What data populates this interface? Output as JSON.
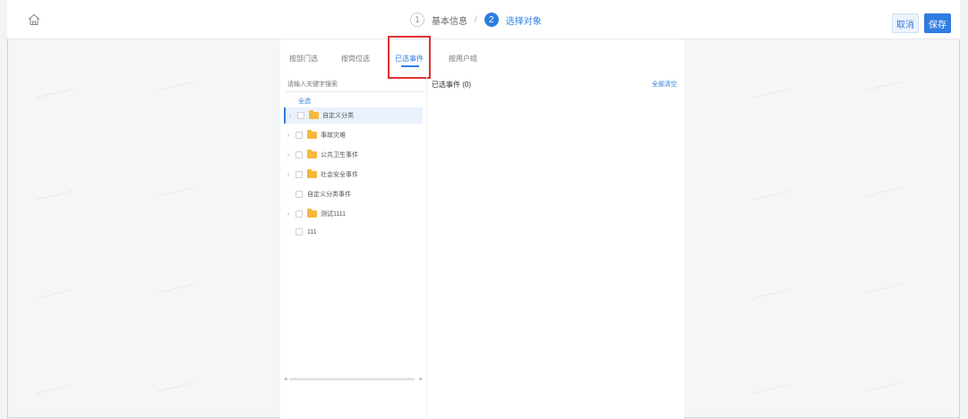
{
  "header": {
    "steps": [
      {
        "num": "1",
        "label": "基本信息"
      },
      {
        "num": "2",
        "label": "选择对象"
      }
    ],
    "cancel_label": "取消",
    "save_label": "保存"
  },
  "tabs": [
    {
      "label": "按部门选"
    },
    {
      "label": "按岗位选"
    },
    {
      "label": "已选事件"
    },
    {
      "label": "按用户组"
    }
  ],
  "left_panel": {
    "search_placeholder": "请输入关键字搜索",
    "select_all": "全选",
    "tree": [
      {
        "label": "自定义分类",
        "has_children": true,
        "folder": true,
        "selected": true
      },
      {
        "label": "事故灾难",
        "has_children": true,
        "folder": true,
        "selected": false
      },
      {
        "label": "公共卫生事件",
        "has_children": true,
        "folder": true,
        "selected": false
      },
      {
        "label": "社会安全事件",
        "has_children": true,
        "folder": true,
        "selected": false
      },
      {
        "label": "自定义分类事件",
        "has_children": false,
        "folder": false,
        "selected": false
      },
      {
        "label": "测试1111",
        "has_children": true,
        "folder": true,
        "selected": false
      },
      {
        "label": "111",
        "has_children": false,
        "folder": false,
        "selected": false
      }
    ]
  },
  "right_panel": {
    "title": "已选事件 (0)",
    "clear_label": "全部清空"
  },
  "colors": {
    "accent": "#2f7de1",
    "highlight_box": "#e0302f",
    "folder": "#f5b83d"
  }
}
